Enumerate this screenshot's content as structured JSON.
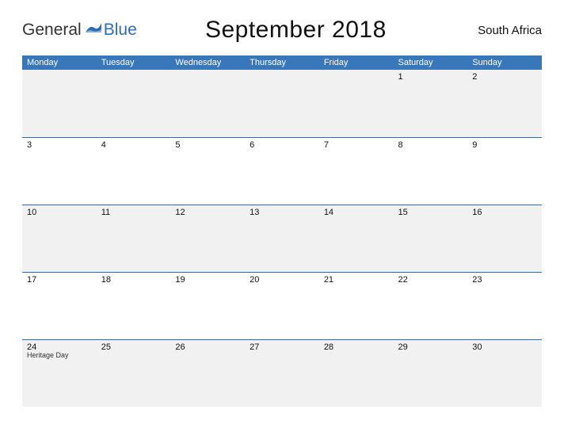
{
  "logo": {
    "part1": "General",
    "part2": "Blue"
  },
  "title": "September 2018",
  "region": "South Africa",
  "day_headers": [
    "Monday",
    "Tuesday",
    "Wednesday",
    "Thursday",
    "Friday",
    "Saturday",
    "Sunday"
  ],
  "weeks": [
    [
      "",
      "",
      "",
      "",
      "",
      "1",
      "2"
    ],
    [
      "3",
      "4",
      "5",
      "6",
      "7",
      "8",
      "9"
    ],
    [
      "10",
      "11",
      "12",
      "13",
      "14",
      "15",
      "16"
    ],
    [
      "17",
      "18",
      "19",
      "20",
      "21",
      "22",
      "23"
    ],
    [
      "24",
      "25",
      "26",
      "27",
      "28",
      "29",
      "30"
    ]
  ],
  "events": {
    "4": {
      "0": "Heritage Day"
    }
  }
}
